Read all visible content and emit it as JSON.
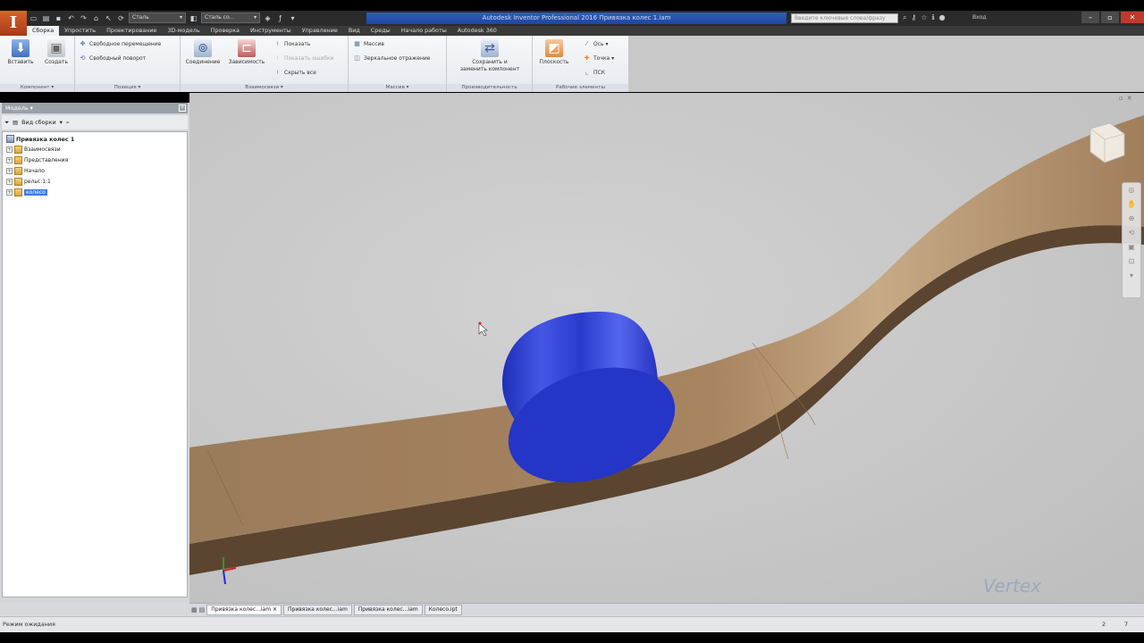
{
  "app": {
    "logo": "I",
    "title": "Autodesk Inventor Professional 2016   Привязка колес 1.iam"
  },
  "qat": {
    "material_select": "Сталь",
    "appearance_select": "Сталь со..."
  },
  "search": {
    "placeholder": "Введите ключевые слова/фразу"
  },
  "signin": {
    "label": "Вход"
  },
  "tabs": [
    "Сборка",
    "Упростить",
    "Проектирование",
    "3D-модель",
    "Проверка",
    "Инструменты",
    "Управление",
    "Вид",
    "Среды",
    "Начало работы",
    "Autodesk 360"
  ],
  "ribbon": {
    "component": {
      "insert": "Вставить",
      "create": "Создать",
      "title": "Компонент ▾"
    },
    "position": {
      "free_move": "Свободное перемещение",
      "free_rotate": "Свободный поворот",
      "title": "Позиция ▾"
    },
    "relationships": {
      "joint": "Соединение",
      "constrain": "Зависимость",
      "show": "Показать",
      "show_sick": "Показать ошибки",
      "hide_all": "Скрыть все",
      "title": "Взаимосвязи ▾"
    },
    "pattern": {
      "pattern": "Массив",
      "mirror": "Зеркальное отражение",
      "title": "Массив ▾"
    },
    "productivity": {
      "save_replace_1": "Сохранить и",
      "save_replace_2": "заменить компонент",
      "title": "Производительность"
    },
    "work_features": {
      "plane": "Плоскость",
      "axis": "Ось ▾",
      "point": "Точка ▾",
      "ucs": "ПСК",
      "title": "Рабочие элементы"
    }
  },
  "browser": {
    "header": "Модель ▾",
    "view": "Вид сборки",
    "root": "Привязка колес 1",
    "items": [
      {
        "label": "Взаимосвязи"
      },
      {
        "label": "Представления"
      },
      {
        "label": "Начало"
      },
      {
        "label": "рельс:1:1"
      },
      {
        "label": "колесо"
      }
    ]
  },
  "doc_tabs": [
    "Привязка колес...iam",
    "Привязка колес...iam",
    "Привязка колес...iam",
    "Колесо.ipt"
  ],
  "status": {
    "text": "Режим ожидания",
    "num1": "2",
    "num2": "7"
  },
  "watermark": "Vertex",
  "colors": {
    "wheel": "#2f3fd0",
    "rail_top": "#a07d58",
    "rail_side": "#5b4530",
    "viewport_bg": "#c6c6c6"
  }
}
